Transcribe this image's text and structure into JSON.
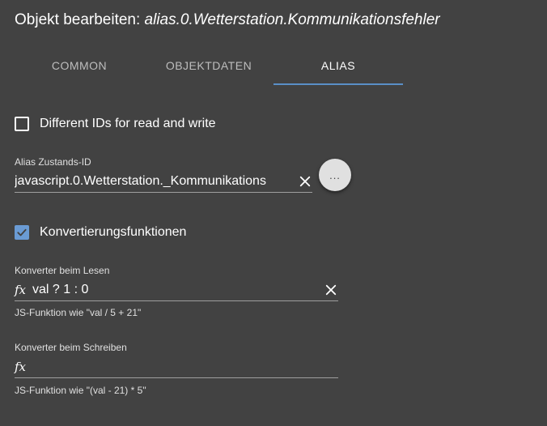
{
  "dialog": {
    "title_prefix": "Objekt bearbeiten: ",
    "object_id": "alias.0.Wetterstation.Kommunikationsfehler"
  },
  "tabs": [
    {
      "label": "COMMON",
      "active": false
    },
    {
      "label": "OBJEKTDATEN",
      "active": false
    },
    {
      "label": "ALIAS",
      "active": true
    }
  ],
  "alias": {
    "different_ids": {
      "label": "Different IDs for read and write",
      "checked": false
    },
    "state_id": {
      "label": "Alias Zustands-ID",
      "value": "javascript.0.Wetterstation._Kommunikations",
      "more_label": "..."
    },
    "conversion": {
      "label": "Konvertierungsfunktionen",
      "checked": true
    },
    "read_converter": {
      "label": "Konverter beim Lesen",
      "fx": "fx",
      "value": "val ? 1 : 0",
      "helper": "JS-Funktion wie \"val / 5 + 21\""
    },
    "write_converter": {
      "label": "Konverter beim Schreiben",
      "fx": "fx",
      "value": "",
      "helper": "JS-Funktion wie \"(val - 21) * 5\""
    }
  },
  "colors": {
    "background": "#424242",
    "accent": "#5a8fc7",
    "checkbox_checked": "#6a9bd4"
  }
}
